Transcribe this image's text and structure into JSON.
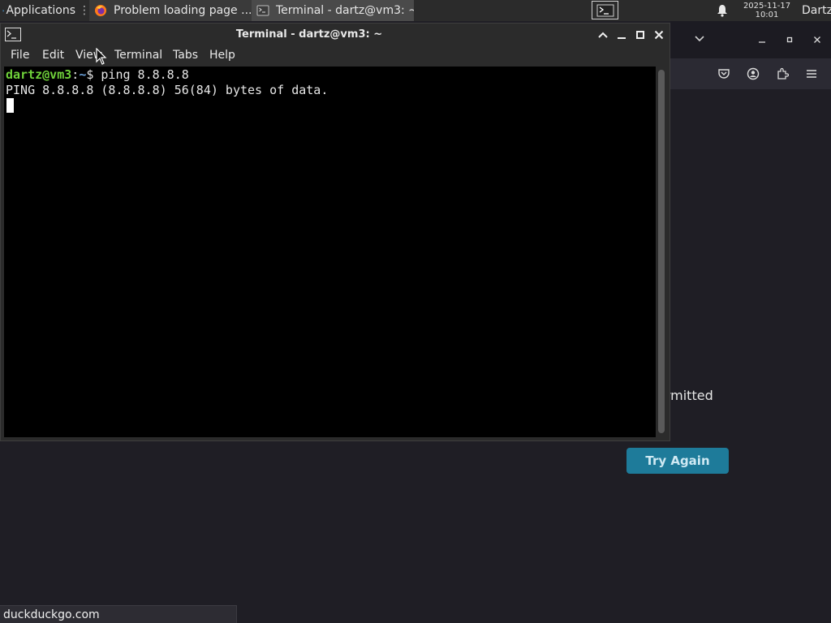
{
  "panel": {
    "applications_label": "Applications",
    "tasks": [
      {
        "label": "Problem loading page ...",
        "icon": "firefox-icon"
      },
      {
        "label": "Terminal - dartz@vm3: ~",
        "icon": "terminal-icon"
      }
    ],
    "workspace_icon": "terminal-icon",
    "clock_date": "2025-11-17",
    "clock_time": "10:01",
    "user": "Dartz"
  },
  "terminal": {
    "title": "Terminal - dartz@vm3: ~",
    "menu": [
      "File",
      "Edit",
      "View",
      "Terminal",
      "Tabs",
      "Help"
    ],
    "prompt_user": "dartz@vm3",
    "prompt_sep": ":",
    "prompt_path": "~",
    "prompt_symbol": "$",
    "command": "ping 8.8.8.8",
    "output_line": "PING 8.8.8.8 (8.8.8.8) 56(84) bytes of data."
  },
  "firefox": {
    "error_text_visible": "ermitted",
    "try_again_label": "Try Again",
    "status_url": "duckduckgo.com"
  },
  "colors": {
    "prompt_user": "#6fd13a",
    "prompt_path": "#6a9fd8",
    "try_again_bg": "#1e7b9a"
  }
}
